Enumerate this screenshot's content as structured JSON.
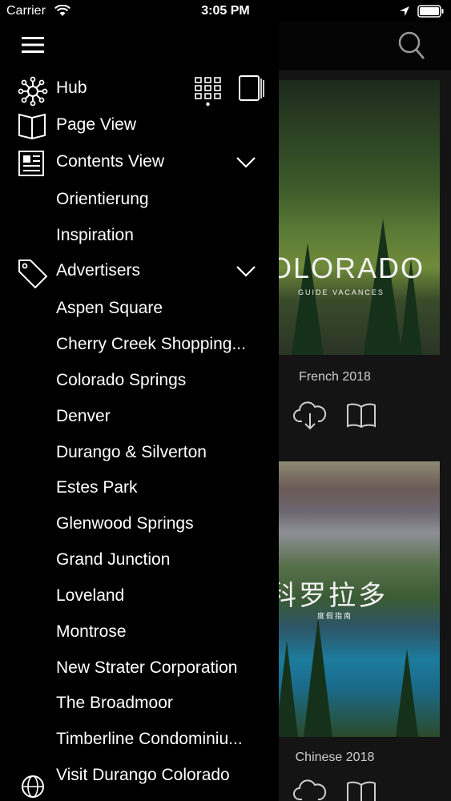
{
  "status_bar": {
    "carrier": "Carrier",
    "time": "3:05 PM"
  },
  "drawer": {
    "items": [
      {
        "label": "Hub",
        "icon": "hub-icon"
      },
      {
        "label": "Page View",
        "icon": "open-book-icon"
      },
      {
        "label": "Contents View",
        "icon": "newspaper-icon",
        "expanded": true
      },
      {
        "label": "Advertisers",
        "icon": "tag-icon",
        "expanded": true
      }
    ],
    "contents_sub": [
      "Orientierung",
      "Inspiration"
    ],
    "advertisers": [
      "Aspen Square",
      "Cherry Creek Shopping...",
      "Colorado Springs",
      "Denver",
      "Durango & Silverton",
      "Estes Park",
      "Glenwood Springs",
      "Grand Junction",
      "Loveland",
      "Montrose",
      "New Strater Corporation",
      "The Broadmoor",
      "Timberline Condominiu...",
      "Visit Durango Colorado"
    ]
  },
  "library": {
    "covers": [
      {
        "caption": "French 2018",
        "title": "OLORADO",
        "subtitle": "GUIDE VACANCES"
      },
      {
        "caption": "Chinese 2018",
        "title": "科罗拉多",
        "subtitle": "度假指南"
      }
    ]
  },
  "colors": {
    "drawer_bg": "#000000",
    "content_bg": "#141414",
    "text": "#ffffff"
  }
}
